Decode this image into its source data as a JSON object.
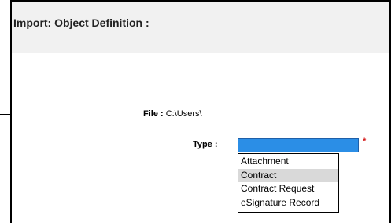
{
  "dialog": {
    "title": "Import: Object Definition :"
  },
  "form": {
    "file_label": "File :",
    "file_value": "C:\\Users\\",
    "type_label": "Type :",
    "type_selected": "",
    "required_mark": "*"
  },
  "dropdown": {
    "options": [
      {
        "label": "Attachment",
        "highlighted": false
      },
      {
        "label": "Contract",
        "highlighted": true
      },
      {
        "label": "Contract Request",
        "highlighted": false
      },
      {
        "label": "eSignature Record",
        "highlighted": false
      }
    ]
  },
  "colors": {
    "selected_field": "#2b8ee6",
    "hover_row": "#d9d9d9",
    "required": "#d61f1f",
    "header_bg": "#f1f1f1"
  }
}
